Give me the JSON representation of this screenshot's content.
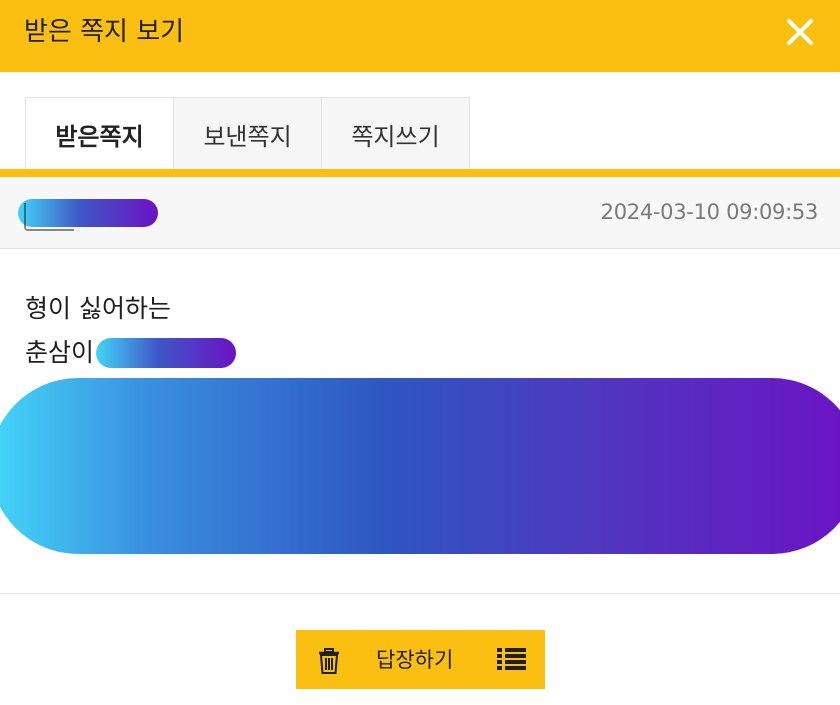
{
  "window": {
    "title": "받은 쪽지 보기",
    "close_icon": "close-icon",
    "accent_color": "#fbbf12"
  },
  "tabs": [
    {
      "label": "받은쪽지",
      "active": true
    },
    {
      "label": "보낸쪽지",
      "active": false
    },
    {
      "label": "쪽지쓰기",
      "active": false
    }
  ],
  "message": {
    "timestamp": "2024-03-10 09:09:53",
    "line1": "형이 싫어하는",
    "line2_prefix": "춘삼이"
  },
  "actions": {
    "delete_icon": "trash-icon",
    "reply_label": "답장하기",
    "list_icon": "list-icon"
  }
}
